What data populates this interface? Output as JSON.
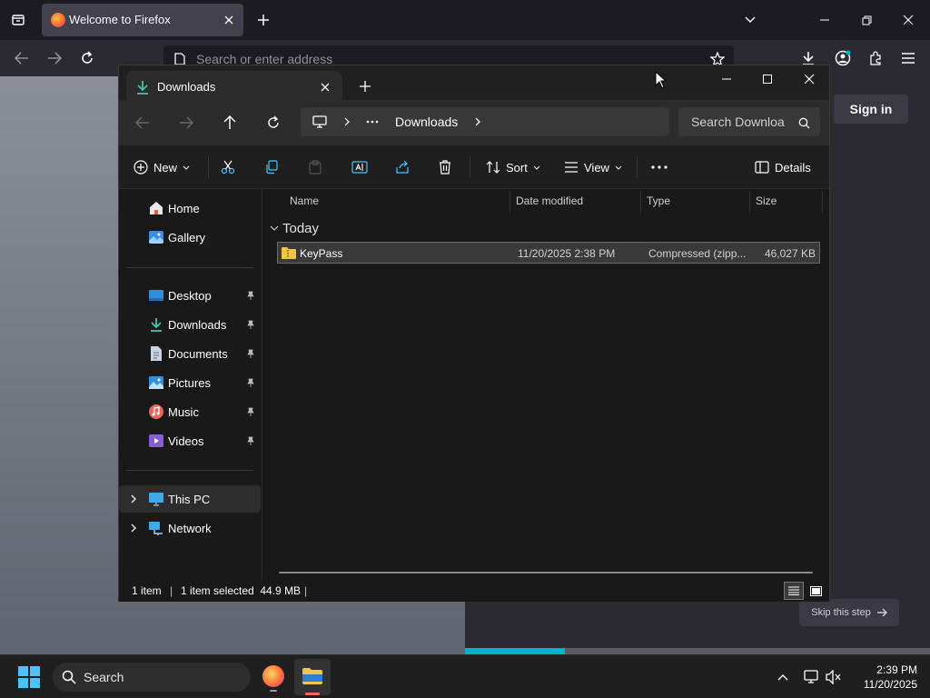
{
  "firefox": {
    "tab_title": "Welcome to Firefox",
    "address_placeholder": "Search or enter address",
    "sign_in_label": "Sign in",
    "skip_label": "Skip this step",
    "progress_fraction": 0.215
  },
  "explorer": {
    "tab_title": "Downloads",
    "breadcrumb_current": "Downloads",
    "search_placeholder": "Search Downloa",
    "commands": {
      "new_label": "New",
      "sort_label": "Sort",
      "view_label": "View",
      "details_label": "Details"
    },
    "sidebar": {
      "top_items": [
        {
          "label": "Home",
          "icon": "home-icon"
        },
        {
          "label": "Gallery",
          "icon": "gallery-icon"
        }
      ],
      "pinned_items": [
        {
          "label": "Desktop",
          "icon": "desktop-icon"
        },
        {
          "label": "Downloads",
          "icon": "downloads-icon"
        },
        {
          "label": "Documents",
          "icon": "documents-icon"
        },
        {
          "label": "Pictures",
          "icon": "pictures-icon"
        },
        {
          "label": "Music",
          "icon": "music-icon"
        },
        {
          "label": "Videos",
          "icon": "videos-icon"
        }
      ],
      "tree_items": [
        {
          "label": "This PC",
          "icon": "pc-icon"
        },
        {
          "label": "Network",
          "icon": "network-icon"
        }
      ]
    },
    "columns": [
      "Name",
      "Date modified",
      "Type",
      "Size"
    ],
    "group_label": "Today",
    "files": [
      {
        "name": "KeyPass",
        "date_modified": "11/20/2025 2:38 PM",
        "type": "Compressed (zipp...",
        "size": "46,027 KB",
        "selected": true
      }
    ],
    "status": {
      "item_count": "1 item",
      "selection": "1 item selected  44.9 MB"
    }
  },
  "taskbar": {
    "search_label": "Search",
    "time": "2:39 PM",
    "date": "11/20/2025"
  },
  "colors": {
    "accent": "#00b3c7",
    "selection": "#3a3a3a",
    "folder": "#f2c447"
  }
}
